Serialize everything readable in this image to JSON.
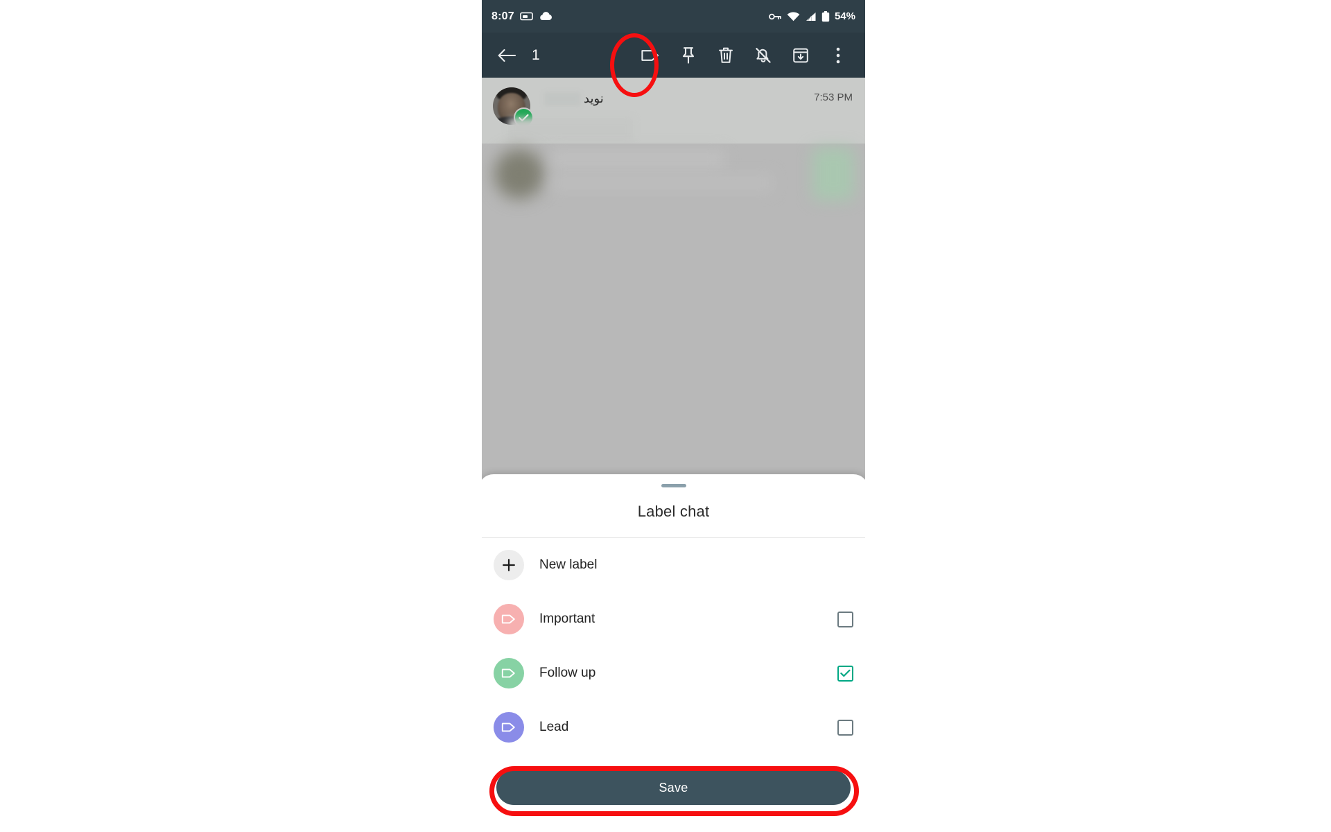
{
  "status_bar": {
    "time": "8:07",
    "battery_text": "54%",
    "left_icons": [
      "sim-card-icon",
      "cloud-icon"
    ],
    "right_icons": [
      "key-icon",
      "wifi-icon",
      "signal-icon",
      "battery-icon"
    ]
  },
  "toolbar": {
    "back_label": "back-arrow",
    "selection_count": "1",
    "actions": [
      {
        "name": "label-chat",
        "icon": "label-tag-icon",
        "highlighted": true
      },
      {
        "name": "pin-chat",
        "icon": "pin-icon",
        "highlighted": false
      },
      {
        "name": "delete-chat",
        "icon": "trash-icon",
        "highlighted": false
      },
      {
        "name": "mute-chat",
        "icon": "bell-slash-icon",
        "highlighted": false
      },
      {
        "name": "archive-chat",
        "icon": "archive-box-icon",
        "highlighted": false
      },
      {
        "name": "more-options",
        "icon": "overflow-menu-icon",
        "highlighted": false
      }
    ]
  },
  "chat": {
    "contact_name": "نوید",
    "timestamp": "7:53 PM",
    "verified_badge": "check-icon"
  },
  "sheet": {
    "title": "Label chat",
    "new_label": {
      "text": "New label",
      "icon": "plus-icon"
    },
    "labels": [
      {
        "text": "Important",
        "color": "#f7b0b0",
        "checked": false
      },
      {
        "text": "Follow up",
        "color": "#87d2a4",
        "checked": true
      },
      {
        "text": "Lead",
        "color": "#8a8ce8",
        "checked": false
      }
    ],
    "save_label": "Save"
  },
  "colors": {
    "status_bar_bg": "#2f3f48",
    "toolbar_bg": "#2b3a43",
    "save_button_bg": "#3d535e",
    "checkbox_checked": "#00a884",
    "annotation": "#f60f10"
  }
}
